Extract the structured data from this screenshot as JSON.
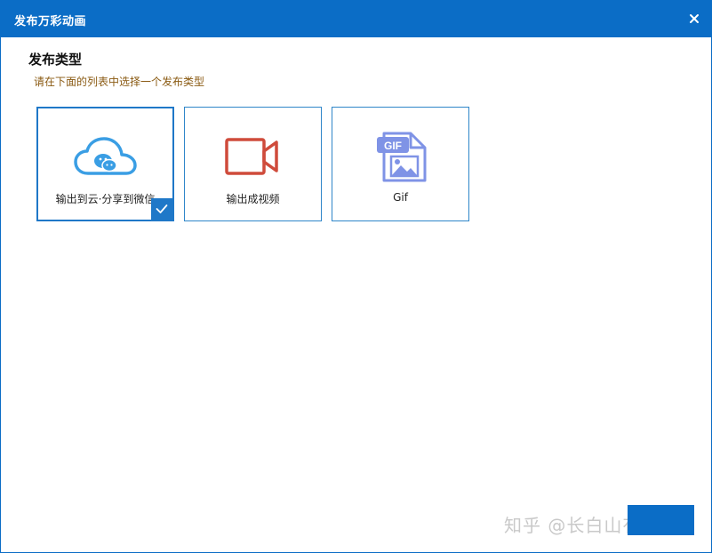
{
  "window": {
    "title": "发布万彩动画"
  },
  "section": {
    "title": "发布类型",
    "hint": "请在下面的列表中选择一个发布类型"
  },
  "options": [
    {
      "label": "输出到云·分享到微信",
      "icon": "cloud-wechat-icon",
      "selected": true
    },
    {
      "label": "输出成视频",
      "icon": "video-camera-icon",
      "selected": false
    },
    {
      "label": "Gif",
      "icon": "gif-file-icon",
      "selected": false
    }
  ],
  "watermark": "知乎 @长白山有只兔",
  "colors": {
    "titlebar": "#0b6dc6",
    "accent": "#1f78c8",
    "cloud": "#3a9ee4",
    "video": "#cf4b3b",
    "gif": "#7f93e6",
    "hint": "#8a5a12"
  }
}
